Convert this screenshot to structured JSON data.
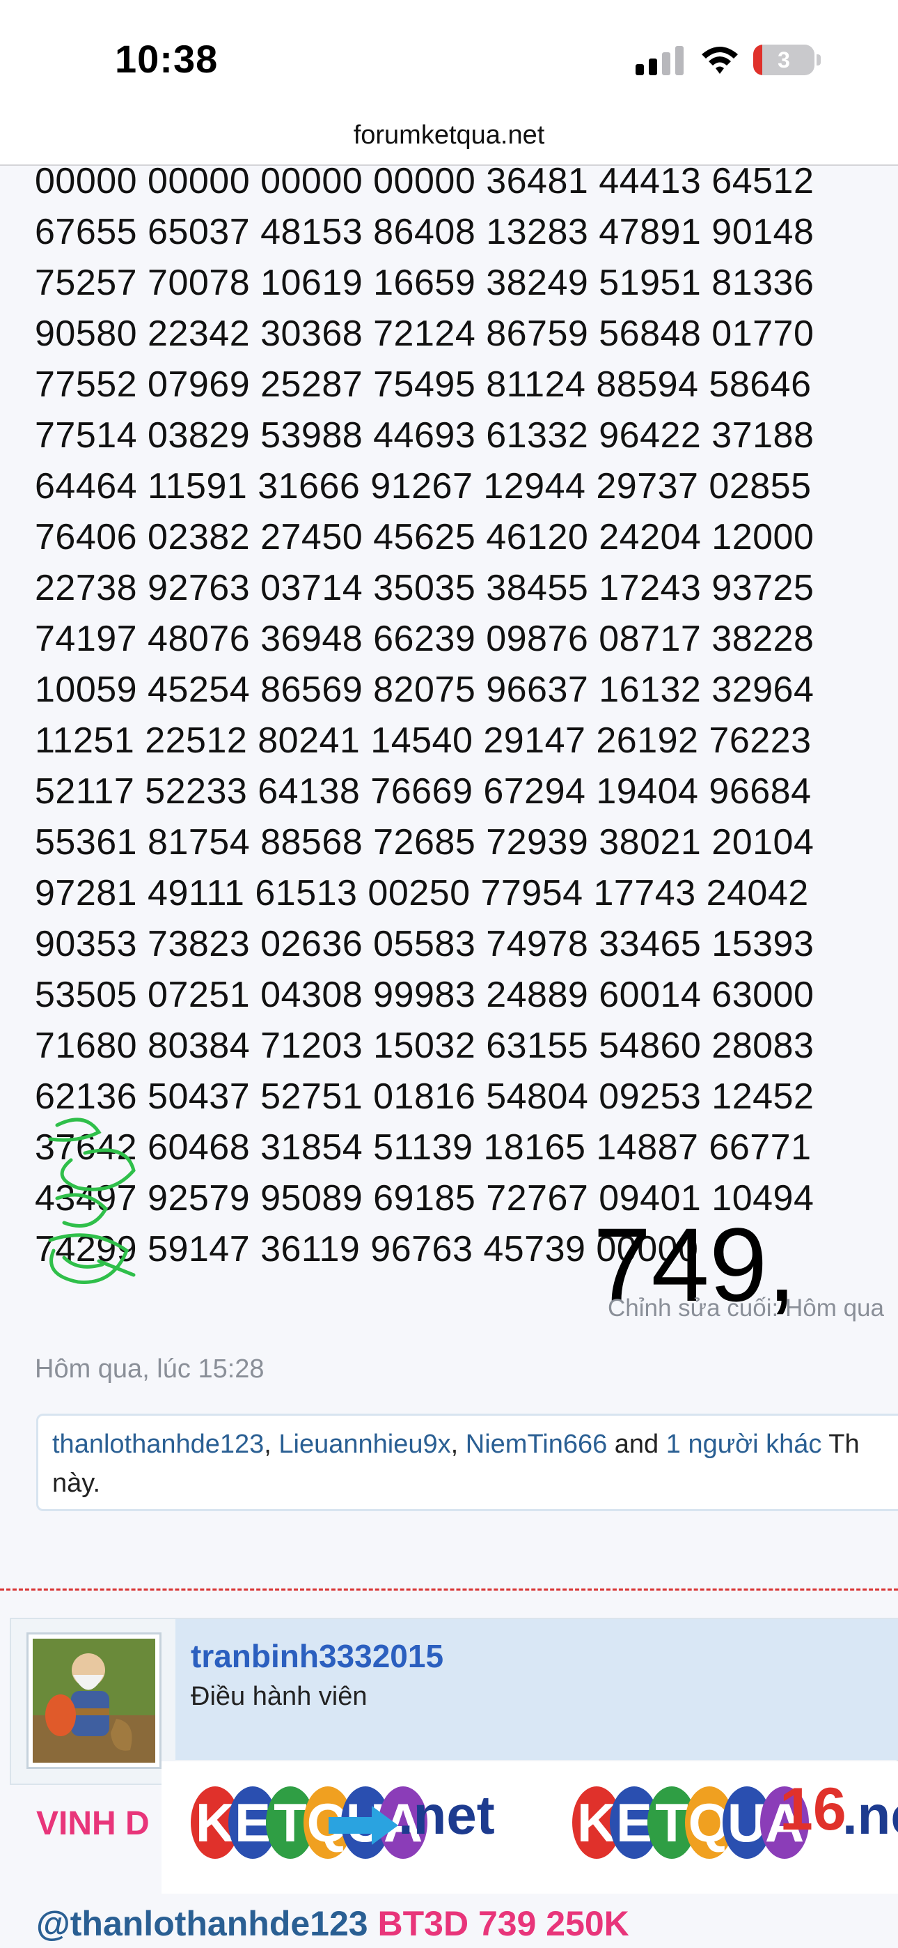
{
  "status_bar": {
    "time": "10:38",
    "battery": "3",
    "battery_percent": 3
  },
  "browser": {
    "url": "forumketqua.net"
  },
  "post": {
    "number_lines": [
      "00000 00000 00000 00000 36481 44413 64512",
      "67655 65037 48153 86408 13283 47891 90148",
      "75257 70078 10619 16659 38249 51951 81336",
      "90580 22342 30368 72124 86759 56848 01770",
      "77552 07969 25287 75495 81124 88594 58646",
      "77514 03829 53988 44693 61332 96422 37188",
      "64464 11591 31666 91267 12944 29737 02855",
      "76406 02382 27450 45625 46120 24204 12000",
      "22738 92763 03714 35035 38455 17243 93725",
      "74197 48076 36948 66239 09876 08717 38228",
      "10059 45254 86569 82075 96637 16132 32964",
      "11251 22512 80241 14540 29147 26192 76223",
      "52117 52233 64138 76669 67294 19404 96684",
      "55361 81754 88568 72685 72939 38021 20104",
      "97281 49111 61513 00250 77954 17743 24042",
      "90353 73823 02636 05583 74978 33465 15393",
      "53505 07251 04308 99983 24889 60014 63000",
      "71680 80384 71203 15032 63155 54860 28083",
      "62136 50437 52751 01816 54804 09253 12452",
      "37642 60468 31854 51139 18165 14887 66771",
      "43497 92579 95089 69185 72767 09401 10494",
      "74299 59147 36119 96763 45739 00000"
    ],
    "overlay_number": "749,",
    "edit_note": "Chỉnh sửa cuối: Hôm qua",
    "timestamp": "Hôm qua, lúc 15:28",
    "likes": {
      "users": [
        "thanlothanhde123",
        "Lieuannhieu9x",
        "NiemTin666"
      ],
      "sep": ", ",
      "and_text": " and ",
      "others": "1 người khác",
      "suffix": " Th",
      "line2": "này."
    }
  },
  "next_post": {
    "username": "tranbinh3332015",
    "role": "Điều hành viên",
    "content_partial": "VINH D",
    "banner": {
      "left_letters": [
        "K",
        "E",
        "T",
        "Q",
        "U",
        "A"
      ],
      "left_suffix": ".net",
      "right_letters": [
        "K",
        "E",
        "T",
        "Q",
        "U",
        "A"
      ],
      "right_number": "16",
      "right_suffix": ".net",
      "ball_colors": [
        "#e0312b",
        "#2a4fb0",
        "#2f9e44",
        "#f0a020",
        "#2a4fb0",
        "#8b3db8"
      ],
      "arrow_color": "#2aa3e0"
    },
    "mention": "@thanlothanhde123",
    "bet_text": " BT3D 739 250K"
  }
}
